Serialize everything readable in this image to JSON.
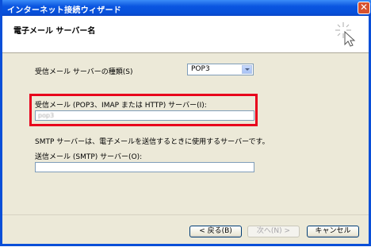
{
  "window": {
    "title": "インターネット接続ウィザード",
    "close_label": "✕"
  },
  "header": {
    "title": "電子メール サーバー名"
  },
  "form": {
    "server_type_label": "受信メール サーバーの種類(S)",
    "server_type_value": "POP3",
    "incoming_label": "受信メール (POP3、IMAP または HTTP) サーバー(I):",
    "incoming_value": "pop3",
    "smtp_note": "SMTP サーバーは、電子メールを送信するときに使用するサーバーです。",
    "outgoing_label": "送信メール (SMTP) サーバー(O):",
    "outgoing_value": ""
  },
  "buttons": {
    "back": "< 戻る(B)",
    "next": "次へ(N) >",
    "cancel": "キャンセル"
  },
  "colors": {
    "highlight": "#e8001c",
    "titlebar": "#0a55e0"
  }
}
